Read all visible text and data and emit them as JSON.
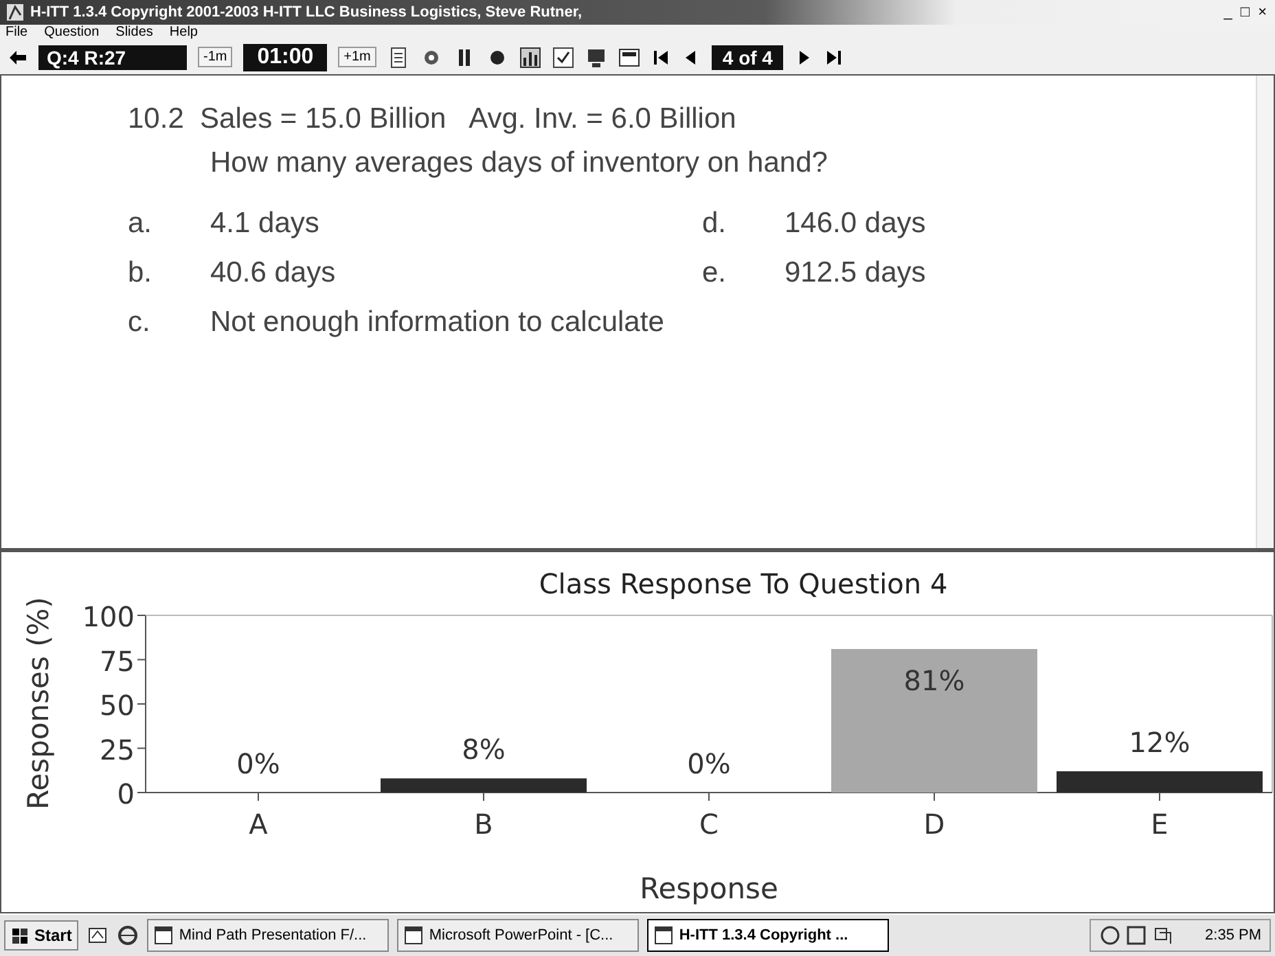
{
  "window": {
    "title": "H-ITT 1.3.4 Copyright 2001-2003 H-ITT LLC Business Logistics, Steve Rutner,",
    "controls": [
      "_",
      "□",
      "×"
    ]
  },
  "menu": [
    "File",
    "Question",
    "Slides",
    "Help"
  ],
  "toolbar": {
    "counter": "Q:4 R:27",
    "minus": "-1m",
    "timer": "01:00",
    "plus": "+1m",
    "position": "4 of 4"
  },
  "question": {
    "heading": "10.2  Sales = 15.0 Billion   Avg. Inv. = 6.0 Billion",
    "prompt": "How many averages days of inventory on hand?",
    "options": [
      {
        "letter": "a.",
        "text": "4.1 days"
      },
      {
        "letter": "d.",
        "text": "146.0 days"
      },
      {
        "letter": "b.",
        "text": "40.6 days"
      },
      {
        "letter": "e.",
        "text": "912.5 days"
      },
      {
        "letter": "c.",
        "text": "Not enough information to calculate"
      }
    ]
  },
  "chart": {
    "chart_data": {
      "type": "bar",
      "title": "Class Response To Question 4",
      "xlabel": "Response",
      "ylabel": "Responses (%)",
      "categories": [
        "A",
        "B",
        "C",
        "D",
        "E"
      ],
      "stacked": true,
      "series": [
        {
          "color": "#2b2b2b",
          "values": [
            0,
            8,
            0,
            null,
            12
          ]
        },
        {
          "color": "#a8a8a8",
          "values": [
            null,
            null,
            null,
            81,
            null
          ]
        }
      ],
      "ylim": [
        0,
        100
      ],
      "yticks": [
        0,
        25,
        50,
        75,
        100
      ],
      "value_labels": [
        "0%",
        "8%",
        "0%",
        "81%",
        "12%"
      ]
    }
  },
  "taskbar": {
    "start": "Start",
    "tasks": [
      {
        "label": "Mind Path Presentation F/...",
        "selected": false
      },
      {
        "label": "Microsoft PowerPoint - [C...",
        "selected": false
      },
      {
        "label": "H-ITT 1.3.4 Copyright ...",
        "selected": true
      }
    ],
    "clock": "2:35 PM"
  }
}
